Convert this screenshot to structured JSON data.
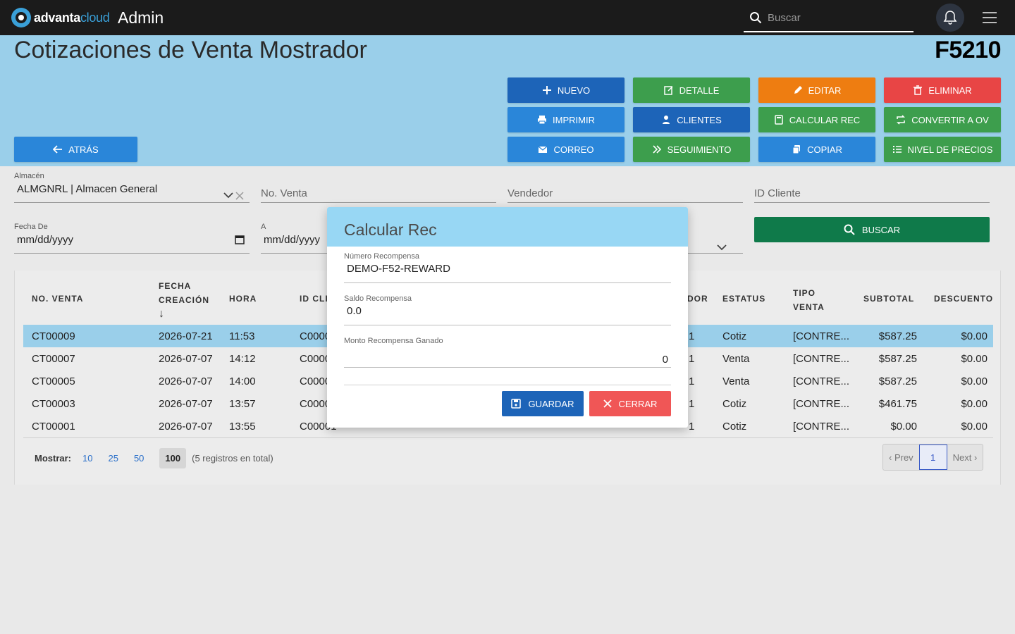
{
  "topbar": {
    "logo_a": "advanta",
    "logo_b": "cloud",
    "title": "Admin",
    "search_placeholder": "Buscar"
  },
  "header": {
    "title": "Cotizaciones de Venta Mostrador",
    "code": "F5210",
    "back_label": "ATRÁS",
    "buttons": {
      "nuevo": "NUEVO",
      "detalle": "DETALLE",
      "editar": "EDITAR",
      "eliminar": "ELIMINAR",
      "imprimir": "IMPRIMIR",
      "clientes": "CLIENTES",
      "calcular_rec": "CALCULAR REC",
      "convertir": "CONVERTIR A OV",
      "correo": "CORREO",
      "seguimiento": "SEGUIMIENTO",
      "copiar": "COPIAR",
      "nivel_precios": "NIVEL DE PRECIOS"
    }
  },
  "filters": {
    "almacen_label": "Almacén",
    "almacen_value": "ALMGNRL | Almacen General",
    "no_venta_placeholder": "No. Venta",
    "vendedor_placeholder": "Vendedor",
    "id_cliente_placeholder": "ID Cliente",
    "fecha_de_label": "Fecha De",
    "fecha_de_value": "mm/dd/yyyy",
    "a_label": "A",
    "a_value": "mm/dd/yyyy",
    "buscar_label": "BUSCAR"
  },
  "table": {
    "headers": {
      "no_venta": "NO. VENTA",
      "fecha_1": "FECHA",
      "fecha_2": "CREACIÓN",
      "sort_arrow": "↓",
      "hora": "HORA",
      "id_cliente": "ID CLI",
      "vendedor": "DOR",
      "estatus": "ESTATUS",
      "tipo_1": "TIPO",
      "tipo_2": "VENTA",
      "subtotal": "SUBTOTAL",
      "descuento": "DESCUENTO"
    },
    "rows": [
      {
        "no": "CT00009",
        "fecha": "2026-07-21",
        "hora": "11:53",
        "cliente": "C0000",
        "vend": "1",
        "estatus": "Cotiz",
        "tipo": "[CONTRE...",
        "subtotal": "$587.25",
        "descuento": "$0.00"
      },
      {
        "no": "CT00007",
        "fecha": "2026-07-07",
        "hora": "14:12",
        "cliente": "C0000",
        "vend": "1",
        "estatus": "Venta",
        "tipo": "[CONTRE...",
        "subtotal": "$587.25",
        "descuento": "$0.00"
      },
      {
        "no": "CT00005",
        "fecha": "2026-07-07",
        "hora": "14:00",
        "cliente": "C0000",
        "vend": "1",
        "estatus": "Venta",
        "tipo": "[CONTRE...",
        "subtotal": "$587.25",
        "descuento": "$0.00"
      },
      {
        "no": "CT00003",
        "fecha": "2026-07-07",
        "hora": "13:57",
        "cliente": "C0000",
        "vend": "1",
        "estatus": "Cotiz",
        "tipo": "[CONTRE...",
        "subtotal": "$461.75",
        "descuento": "$0.00"
      },
      {
        "no": "CT00001",
        "fecha": "2026-07-07",
        "hora": "13:55",
        "cliente": "C00001",
        "vend": "1",
        "estatus": "Cotiz",
        "tipo": "[CONTRE...",
        "subtotal": "$0.00",
        "descuento": "$0.00"
      }
    ],
    "pager": {
      "mostrar": "Mostrar:",
      "opt_10": "10",
      "opt_25": "25",
      "opt_50": "50",
      "opt_100": "100",
      "total": "(5 registros en total)",
      "prev": "‹ Prev",
      "current": "1",
      "next": "Next ›"
    }
  },
  "modal": {
    "title": "Calcular Rec",
    "numero_label": "Número Recompensa",
    "numero_value": "DEMO-F52-REWARD",
    "saldo_label": "Saldo Recompensa",
    "saldo_value": "0.0",
    "monto_label": "Monto Recompensa Ganado",
    "monto_value": "0",
    "guardar": "GUARDAR",
    "cerrar": "CERRAR"
  }
}
